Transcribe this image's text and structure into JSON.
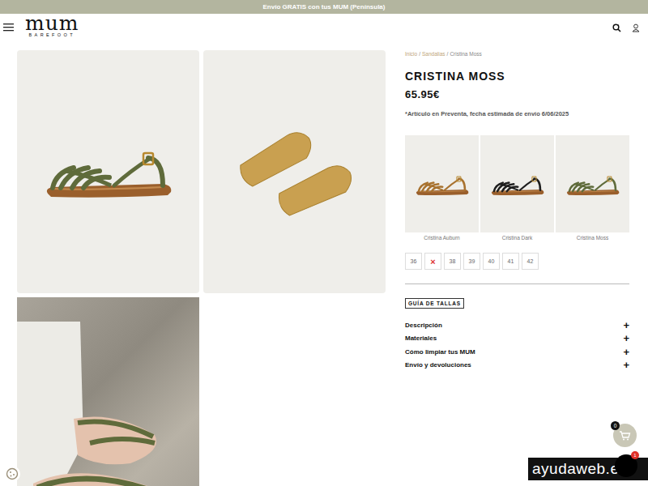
{
  "announcement": "Envío GRATIS con tus MUM (Península)",
  "logo": {
    "main": "mum",
    "sub": "BAREFOOT"
  },
  "breadcrumb": {
    "separator": "/",
    "items": [
      {
        "label": "Inicio",
        "link": true
      },
      {
        "label": "Sandalias",
        "link": true
      },
      {
        "label": "Cristina Moss",
        "link": false
      }
    ]
  },
  "product": {
    "title": "CRISTINA MOSS",
    "price": "65.95€",
    "notice": "*Artículo en Preventa, fecha estimada de envío 6/06/2025",
    "color": "#5f6b3b"
  },
  "variants": [
    {
      "label": "Cristina Auburn",
      "color": "#a8722f"
    },
    {
      "label": "Cristina Dark",
      "color": "#1e1e1e"
    },
    {
      "label": "Cristina Moss",
      "color": "#5f6b3b"
    }
  ],
  "sizes": [
    {
      "label": "36",
      "available": true
    },
    {
      "label": "×",
      "available": false
    },
    {
      "label": "38",
      "available": true
    },
    {
      "label": "39",
      "available": true
    },
    {
      "label": "40",
      "available": true
    },
    {
      "label": "41",
      "available": true
    },
    {
      "label": "42",
      "available": true
    }
  ],
  "size_guide": "GUÍA DE TALLAS",
  "accordion": [
    {
      "label": "Descripción",
      "icon": "+",
      "expanded": false
    },
    {
      "label": "Materiales",
      "icon": "+",
      "expanded": false
    },
    {
      "label": "Cómo limpiar tus MUM",
      "icon": "+",
      "expanded": false
    },
    {
      "label": "Envío y devoluciones",
      "icon": "+",
      "expanded": false
    }
  ],
  "cart": {
    "count": "0"
  },
  "chat": {
    "badge": "1"
  },
  "watermark": "ayudaweb.es"
}
